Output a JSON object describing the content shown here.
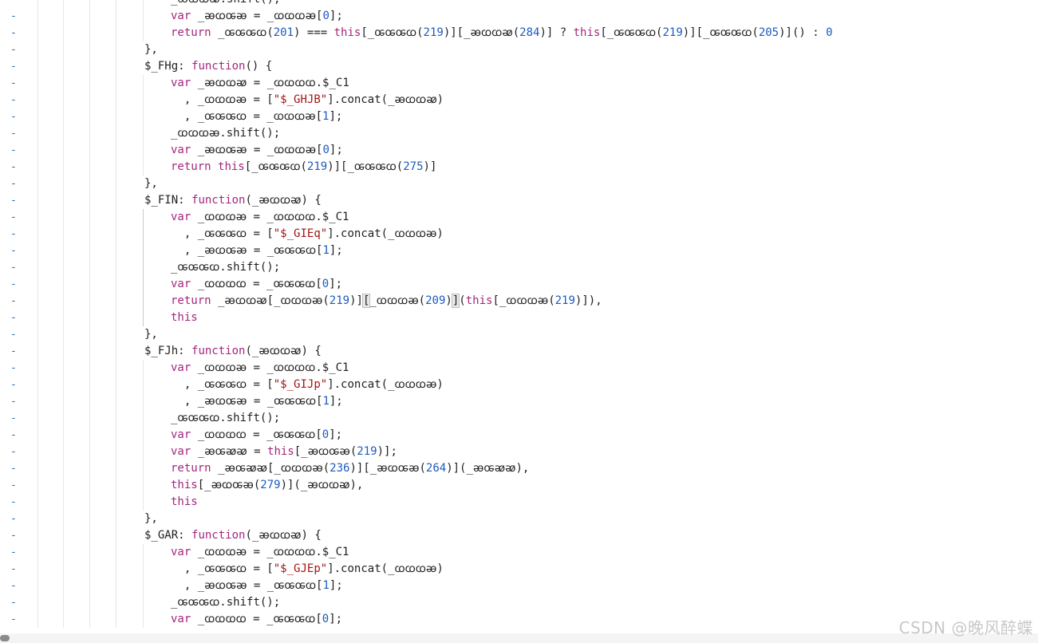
{
  "gutter_marker": "-",
  "lines": [
    {
      "indent": 5,
      "tokens": [
        {
          "t": "_ꭂꭃꭃꭁ.shift();",
          "c": "prop"
        }
      ]
    },
    {
      "indent": 5,
      "tokens": [
        {
          "t": "var",
          "c": "kw"
        },
        {
          "t": " _ꭂꭃꭀꭂ = _ꭃꭃꭃꭂ[",
          "c": "prop"
        },
        {
          "t": "0",
          "c": "num"
        },
        {
          "t": "];",
          "c": "prop"
        }
      ]
    },
    {
      "indent": 5,
      "tokens": [
        {
          "t": "return",
          "c": "kw"
        },
        {
          "t": " _ꭀꭀꭀꭃ(",
          "c": "prop"
        },
        {
          "t": "201",
          "c": "num"
        },
        {
          "t": ") === ",
          "c": "op"
        },
        {
          "t": "this",
          "c": "kw"
        },
        {
          "t": "[_ꭀꭀꭀꭃ(",
          "c": "prop"
        },
        {
          "t": "219",
          "c": "num"
        },
        {
          "t": ")][_ꭂꭃꭃꭁ(",
          "c": "prop"
        },
        {
          "t": "284",
          "c": "num"
        },
        {
          "t": ")] ? ",
          "c": "prop"
        },
        {
          "t": "this",
          "c": "kw"
        },
        {
          "t": "[_ꭀꭀꭀꭃ(",
          "c": "prop"
        },
        {
          "t": "219",
          "c": "num"
        },
        {
          "t": ")][_ꭀꭀꭀꭃ(",
          "c": "prop"
        },
        {
          "t": "205",
          "c": "num"
        },
        {
          "t": ")]() : ",
          "c": "prop"
        },
        {
          "t": "0",
          "c": "num"
        }
      ]
    },
    {
      "indent": 4,
      "tokens": [
        {
          "t": "},",
          "c": "prop"
        }
      ]
    },
    {
      "indent": 4,
      "tokens": [
        {
          "t": "$_FHg: ",
          "c": "prop"
        },
        {
          "t": "function",
          "c": "kw"
        },
        {
          "t": "() {",
          "c": "prop"
        }
      ]
    },
    {
      "indent": 5,
      "tokens": [
        {
          "t": "var",
          "c": "kw"
        },
        {
          "t": " _ꭂꭃꭃꭁ = _ꭃꭃꭃꭃ.$_C1",
          "c": "prop"
        }
      ]
    },
    {
      "indent": 5,
      "tokens": [
        {
          "t": "  , _ꭃꭃꭃꭂ = [",
          "c": "prop"
        },
        {
          "t": "\"$_GHJB\"",
          "c": "str"
        },
        {
          "t": "].concat(_ꭂꭃꭃꭁ)",
          "c": "prop"
        }
      ]
    },
    {
      "indent": 5,
      "tokens": [
        {
          "t": "  , _ꭀꭀꭀꭃ = _ꭃꭃꭃꭂ[",
          "c": "prop"
        },
        {
          "t": "1",
          "c": "num"
        },
        {
          "t": "];",
          "c": "prop"
        }
      ]
    },
    {
      "indent": 5,
      "tokens": [
        {
          "t": "_ꭃꭃꭃꭂ.shift();",
          "c": "prop"
        }
      ]
    },
    {
      "indent": 5,
      "tokens": [
        {
          "t": "var",
          "c": "kw"
        },
        {
          "t": " _ꭂꭃꭀꭂ = _ꭃꭃꭃꭂ[",
          "c": "prop"
        },
        {
          "t": "0",
          "c": "num"
        },
        {
          "t": "];",
          "c": "prop"
        }
      ]
    },
    {
      "indent": 5,
      "tokens": [
        {
          "t": "return",
          "c": "kw"
        },
        {
          "t": " ",
          "c": "prop"
        },
        {
          "t": "this",
          "c": "kw"
        },
        {
          "t": "[_ꭀꭀꭀꭃ(",
          "c": "prop"
        },
        {
          "t": "219",
          "c": "num"
        },
        {
          "t": ")][_ꭀꭀꭀꭃ(",
          "c": "prop"
        },
        {
          "t": "275",
          "c": "num"
        },
        {
          "t": ")]",
          "c": "prop"
        }
      ]
    },
    {
      "indent": 4,
      "tokens": [
        {
          "t": "},",
          "c": "prop"
        }
      ]
    },
    {
      "indent": 4,
      "tokens": [
        {
          "t": "$_FIN: ",
          "c": "prop"
        },
        {
          "t": "function",
          "c": "kw"
        },
        {
          "t": "(_ꭂꭃꭃꭁ) {",
          "c": "prop"
        }
      ]
    },
    {
      "indent": 5,
      "tokens": [
        {
          "t": "var",
          "c": "kw"
        },
        {
          "t": " _ꭃꭃꭃꭂ = _ꭃꭃꭃꭃ.$_C1",
          "c": "prop"
        }
      ]
    },
    {
      "indent": 5,
      "tokens": [
        {
          "t": "  , _ꭀꭀꭀꭃ = [",
          "c": "prop"
        },
        {
          "t": "\"$_GIEq\"",
          "c": "str"
        },
        {
          "t": "].concat(_ꭃꭃꭃꭂ)",
          "c": "prop"
        }
      ]
    },
    {
      "indent": 5,
      "tokens": [
        {
          "t": "  , _ꭂꭃꭀꭂ = _ꭀꭀꭀꭃ[",
          "c": "prop"
        },
        {
          "t": "1",
          "c": "num"
        },
        {
          "t": "];",
          "c": "prop"
        }
      ]
    },
    {
      "indent": 5,
      "tokens": [
        {
          "t": "_ꭀꭀꭀꭃ.shift();",
          "c": "prop"
        }
      ]
    },
    {
      "indent": 5,
      "tokens": [
        {
          "t": "var",
          "c": "kw"
        },
        {
          "t": " _ꭃꭃꭃꭃ = _ꭀꭀꭀꭃ[",
          "c": "prop"
        },
        {
          "t": "0",
          "c": "num"
        },
        {
          "t": "];",
          "c": "prop"
        }
      ]
    },
    {
      "indent": 5,
      "tokens": [
        {
          "t": "return",
          "c": "kw"
        },
        {
          "t": " _ꭂꭃꭃꭁ[_ꭃꭃꭃꭂ(",
          "c": "prop"
        },
        {
          "t": "219",
          "c": "num"
        },
        {
          "t": ")]",
          "c": "prop"
        },
        {
          "t": "[",
          "c": "hl"
        },
        {
          "t": "_ꭃꭃꭃꭂ(",
          "c": "prop"
        },
        {
          "t": "209",
          "c": "num"
        },
        {
          "t": ")",
          "c": "prop"
        },
        {
          "t": "]",
          "c": "hl"
        },
        {
          "t": "(",
          "c": "prop"
        },
        {
          "t": "this",
          "c": "kw"
        },
        {
          "t": "[_ꭃꭃꭃꭂ(",
          "c": "prop"
        },
        {
          "t": "219",
          "c": "num"
        },
        {
          "t": ")]),",
          "c": "prop"
        }
      ]
    },
    {
      "indent": 5,
      "tokens": [
        {
          "t": "this",
          "c": "kw"
        }
      ]
    },
    {
      "indent": 4,
      "tokens": [
        {
          "t": "},",
          "c": "prop"
        }
      ]
    },
    {
      "indent": 4,
      "tokens": [
        {
          "t": "$_FJh: ",
          "c": "prop"
        },
        {
          "t": "function",
          "c": "kw"
        },
        {
          "t": "(_ꭂꭃꭃꭁ) {",
          "c": "prop"
        }
      ]
    },
    {
      "indent": 5,
      "tokens": [
        {
          "t": "var",
          "c": "kw"
        },
        {
          "t": " _ꭃꭃꭃꭂ = _ꭃꭃꭃꭃ.$_C1",
          "c": "prop"
        }
      ]
    },
    {
      "indent": 5,
      "tokens": [
        {
          "t": "  , _ꭀꭀꭀꭃ = [",
          "c": "prop"
        },
        {
          "t": "\"$_GIJp\"",
          "c": "str"
        },
        {
          "t": "].concat(_ꭃꭃꭃꭂ)",
          "c": "prop"
        }
      ]
    },
    {
      "indent": 5,
      "tokens": [
        {
          "t": "  , _ꭂꭃꭀꭂ = _ꭀꭀꭀꭃ[",
          "c": "prop"
        },
        {
          "t": "1",
          "c": "num"
        },
        {
          "t": "];",
          "c": "prop"
        }
      ]
    },
    {
      "indent": 5,
      "tokens": [
        {
          "t": "_ꭀꭀꭀꭃ.shift();",
          "c": "prop"
        }
      ]
    },
    {
      "indent": 5,
      "tokens": [
        {
          "t": "var",
          "c": "kw"
        },
        {
          "t": " _ꭃꭃꭃꭃ = _ꭀꭀꭀꭃ[",
          "c": "prop"
        },
        {
          "t": "0",
          "c": "num"
        },
        {
          "t": "];",
          "c": "prop"
        }
      ]
    },
    {
      "indent": 5,
      "tokens": [
        {
          "t": "var",
          "c": "kw"
        },
        {
          "t": " _ꭂꭀꭁꭁ = ",
          "c": "prop"
        },
        {
          "t": "this",
          "c": "kw"
        },
        {
          "t": "[_ꭂꭃꭀꭂ(",
          "c": "prop"
        },
        {
          "t": "219",
          "c": "num"
        },
        {
          "t": ")];",
          "c": "prop"
        }
      ]
    },
    {
      "indent": 5,
      "tokens": [
        {
          "t": "return",
          "c": "kw"
        },
        {
          "t": " _ꭂꭀꭁꭁ[_ꭃꭃꭃꭂ(",
          "c": "prop"
        },
        {
          "t": "236",
          "c": "num"
        },
        {
          "t": ")][_ꭂꭃꭀꭂ(",
          "c": "prop"
        },
        {
          "t": "264",
          "c": "num"
        },
        {
          "t": ")](_ꭂꭀꭁꭁ),",
          "c": "prop"
        }
      ]
    },
    {
      "indent": 5,
      "tokens": [
        {
          "t": "this",
          "c": "kw"
        },
        {
          "t": "[_ꭂꭃꭀꭂ(",
          "c": "prop"
        },
        {
          "t": "279",
          "c": "num"
        },
        {
          "t": ")](_ꭂꭃꭃꭁ),",
          "c": "prop"
        }
      ]
    },
    {
      "indent": 5,
      "tokens": [
        {
          "t": "this",
          "c": "kw"
        }
      ]
    },
    {
      "indent": 4,
      "tokens": [
        {
          "t": "},",
          "c": "prop"
        }
      ]
    },
    {
      "indent": 4,
      "tokens": [
        {
          "t": "$_GAR: ",
          "c": "prop"
        },
        {
          "t": "function",
          "c": "kw"
        },
        {
          "t": "(_ꭂꭃꭃꭁ) {",
          "c": "prop"
        }
      ]
    },
    {
      "indent": 5,
      "tokens": [
        {
          "t": "var",
          "c": "kw"
        },
        {
          "t": " _ꭃꭃꭃꭂ = _ꭃꭃꭃꭃ.$_C1",
          "c": "prop"
        }
      ]
    },
    {
      "indent": 5,
      "tokens": [
        {
          "t": "  , _ꭀꭀꭀꭃ = [",
          "c": "prop"
        },
        {
          "t": "\"$_GJEp\"",
          "c": "str"
        },
        {
          "t": "].concat(_ꭃꭃꭃꭂ)",
          "c": "prop"
        }
      ]
    },
    {
      "indent": 5,
      "tokens": [
        {
          "t": "  , _ꭂꭃꭀꭂ = _ꭀꭀꭀꭃ[",
          "c": "prop"
        },
        {
          "t": "1",
          "c": "num"
        },
        {
          "t": "];",
          "c": "prop"
        }
      ]
    },
    {
      "indent": 5,
      "tokens": [
        {
          "t": "_ꭀꭀꭀꭃ.shift();",
          "c": "prop"
        }
      ]
    },
    {
      "indent": 5,
      "tokens": [
        {
          "t": "var",
          "c": "kw"
        },
        {
          "t": " _ꭃꭃꭃꭃ = _ꭀꭀꭀꭃ[",
          "c": "prop"
        },
        {
          "t": "0",
          "c": "num"
        },
        {
          "t": "];",
          "c": "prop"
        }
      ]
    }
  ],
  "watermark": "CSDN @晚风醉蝶"
}
